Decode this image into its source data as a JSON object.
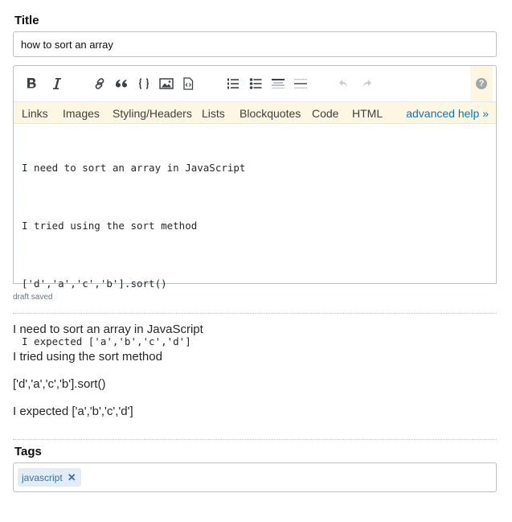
{
  "title_section": {
    "label": "Title",
    "value": "how to sort an array"
  },
  "toolbar": {
    "buttons": [
      {
        "name": "bold",
        "icon": "bold-icon"
      },
      {
        "name": "italic",
        "icon": "italic-icon"
      },
      {
        "name": "link",
        "icon": "link-icon"
      },
      {
        "name": "blockquote",
        "icon": "quote-icon"
      },
      {
        "name": "code",
        "icon": "code-braces-icon"
      },
      {
        "name": "image",
        "icon": "image-icon"
      },
      {
        "name": "snippet",
        "icon": "snippet-icon"
      },
      {
        "name": "ordered-list",
        "icon": "ordered-list-icon"
      },
      {
        "name": "bulleted-list",
        "icon": "bulleted-list-icon"
      },
      {
        "name": "heading",
        "icon": "heading-icon"
      },
      {
        "name": "horizontal-rule",
        "icon": "horizontal-rule-icon"
      },
      {
        "name": "undo",
        "icon": "undo-icon"
      },
      {
        "name": "redo",
        "icon": "redo-icon"
      }
    ],
    "help_glyph": "?"
  },
  "help_bar": {
    "links": [
      "Links",
      "Images",
      "Styling/Headers",
      "Lists",
      "Blockquotes",
      "Code",
      "HTML"
    ],
    "advanced": "advanced help »"
  },
  "editor": {
    "lines": [
      "I need to sort an array in JavaScript",
      "I tried using the sort method",
      "['d','a','c','b'].sort()",
      "I expected ['a','b','c','d']"
    ]
  },
  "status": {
    "draft": "draft saved"
  },
  "preview": {
    "paragraphs": [
      "I need to sort an array in JavaScript",
      "I tried using the sort method",
      "['d','a','c','b'].sort()",
      "I expected ['a','b','c','d']"
    ]
  },
  "tags_section": {
    "label": "Tags",
    "tags": [
      {
        "name": "javascript",
        "remove_glyph": "✕"
      }
    ]
  }
}
